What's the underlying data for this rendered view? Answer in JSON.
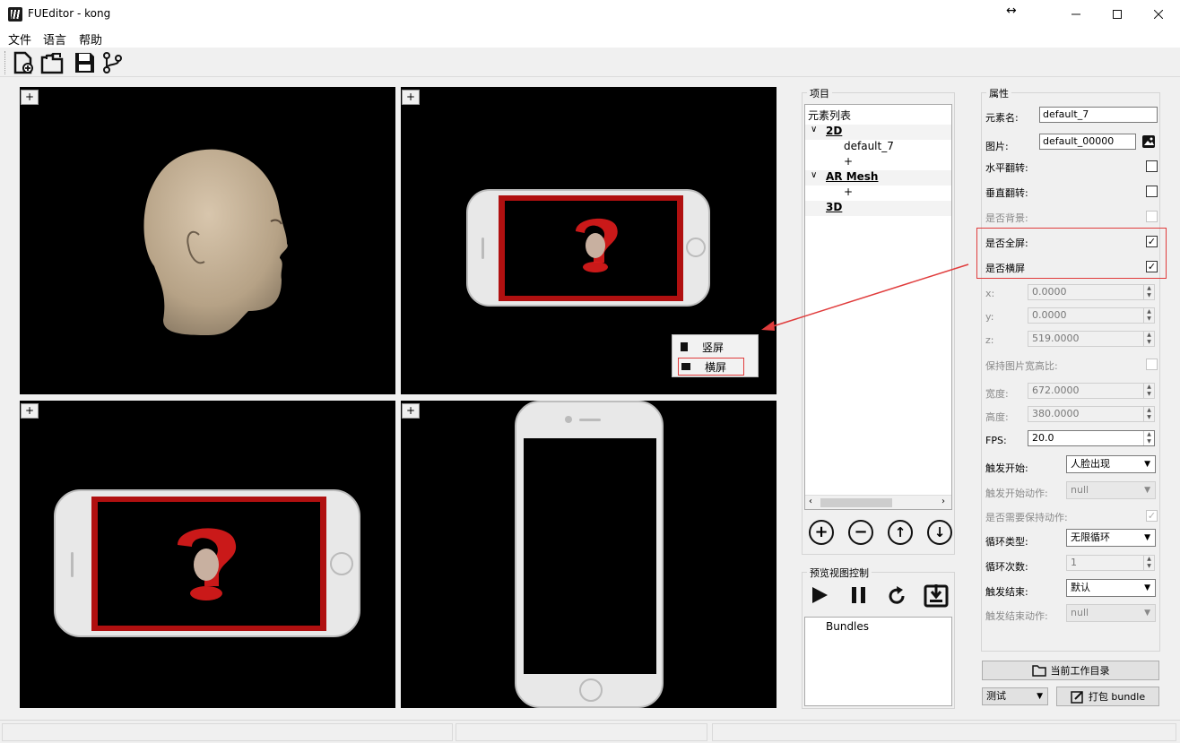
{
  "window": {
    "title": "FUEditor - kong"
  },
  "menu": {
    "file": "文件",
    "language": "语言",
    "help": "帮助"
  },
  "toolbar": {
    "icons": [
      "new-file-icon",
      "open-folder-icon",
      "save-icon",
      "branch-icon"
    ]
  },
  "viewports": {
    "add_label": "+"
  },
  "context_menu": {
    "portrait": "竖屏",
    "landscape": "横屏"
  },
  "project": {
    "title": "项目",
    "tree": {
      "root": "元素列表",
      "group_2d": "2D",
      "item_default": "default_7",
      "add": "+",
      "group_ar": "AR Mesh",
      "group_3d": "3D"
    }
  },
  "preview": {
    "title": "预览视图控制",
    "bundles_label": "Bundles"
  },
  "properties": {
    "title": "属性",
    "element_name_label": "元素名:",
    "element_name_value": "default_7",
    "image_label": "图片:",
    "image_value": "default_00000",
    "hflip_label": "水平翻转:",
    "vflip_label": "垂直翻转:",
    "background_label": "是否背景:",
    "fullscreen_label": "是否全屏:",
    "landscape_label": "是否横屏",
    "x_label": "x:",
    "x_value": "0.0000",
    "y_label": "y:",
    "y_value": "0.0000",
    "z_label": "z:",
    "z_value": "519.0000",
    "keep_ratio_label": "保持图片宽高比:",
    "width_label": "宽度:",
    "width_value": "672.0000",
    "height_label": "高度:",
    "height_value": "380.0000",
    "fps_label": "FPS:",
    "fps_value": "20.0",
    "trigger_start_label": "触发开始:",
    "trigger_start_value": "人脸出现",
    "trigger_start_action_label": "触发开始动作:",
    "trigger_start_action_value": "null",
    "keep_action_label": "是否需要保持动作:",
    "loop_type_label": "循环类型:",
    "loop_type_value": "无限循环",
    "loop_count_label": "循环次数:",
    "loop_count_value": "1",
    "trigger_end_label": "触发结束:",
    "trigger_end_value": "默认",
    "trigger_end_action_label": "触发结束动作:",
    "trigger_end_action_value": "null",
    "workdir_button": "当前工作目录",
    "mode_value": "测试",
    "pack_button": "打包 bundle"
  },
  "colors": {
    "accent_red": "#e03c3c",
    "viewport_bg": "#000000",
    "phone_border": "#b01010"
  }
}
